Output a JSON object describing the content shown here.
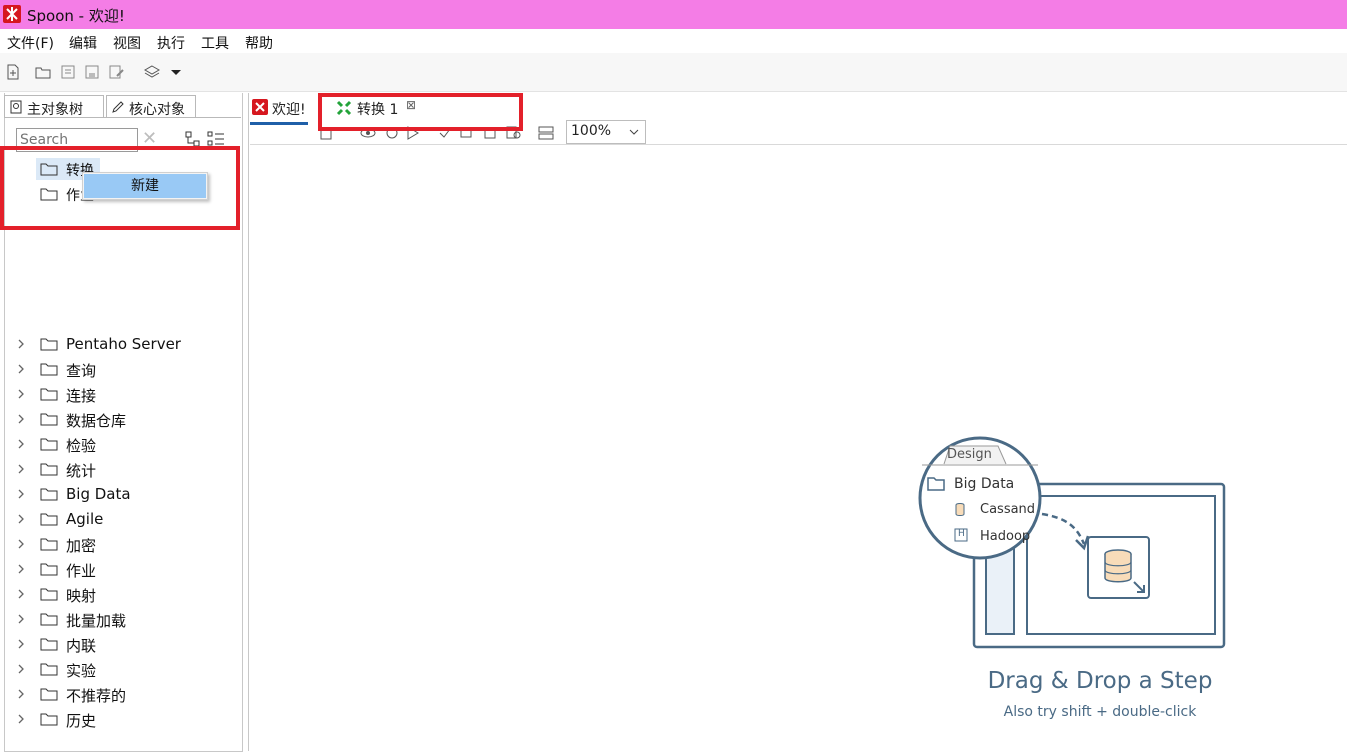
{
  "window": {
    "title": "Spoon - 欢迎!"
  },
  "menubar": {
    "items": [
      "文件(F)",
      "编辑",
      "视图",
      "执行",
      "工具",
      "帮助"
    ]
  },
  "left_panel": {
    "tabs": [
      "主对象树",
      "核心对象"
    ],
    "search_placeholder": "Search",
    "top_tree": [
      "转换",
      "作业"
    ],
    "context_menu": {
      "items": [
        "新建"
      ]
    },
    "core_tree": [
      "Pentaho Server",
      "查询",
      "连接",
      "数据仓库",
      "检验",
      "统计",
      "Big Data",
      "Agile",
      "加密",
      "作业",
      "映射",
      "批量加载",
      "内联",
      "实验",
      "不推荐的",
      "历史"
    ]
  },
  "editor": {
    "tabs": [
      {
        "label": "欢迎!",
        "icon": "spoon-icon",
        "closable": false
      },
      {
        "label": "转换 1",
        "icon": "transformation-icon",
        "closable": true
      }
    ],
    "zoom": "100%"
  },
  "drag_drop_hint": {
    "tab_label": "Design",
    "folder_label": "Big Data",
    "step1": "Cassandr",
    "step2": "Hadoop",
    "title": "Drag & Drop a Step",
    "subtitle": "Also try shift + double-click"
  },
  "colors": {
    "titlebar": "#f47de6",
    "highlight": "#e3202a",
    "selection": "#99c9f5",
    "hint_text": "#4a6a85"
  }
}
